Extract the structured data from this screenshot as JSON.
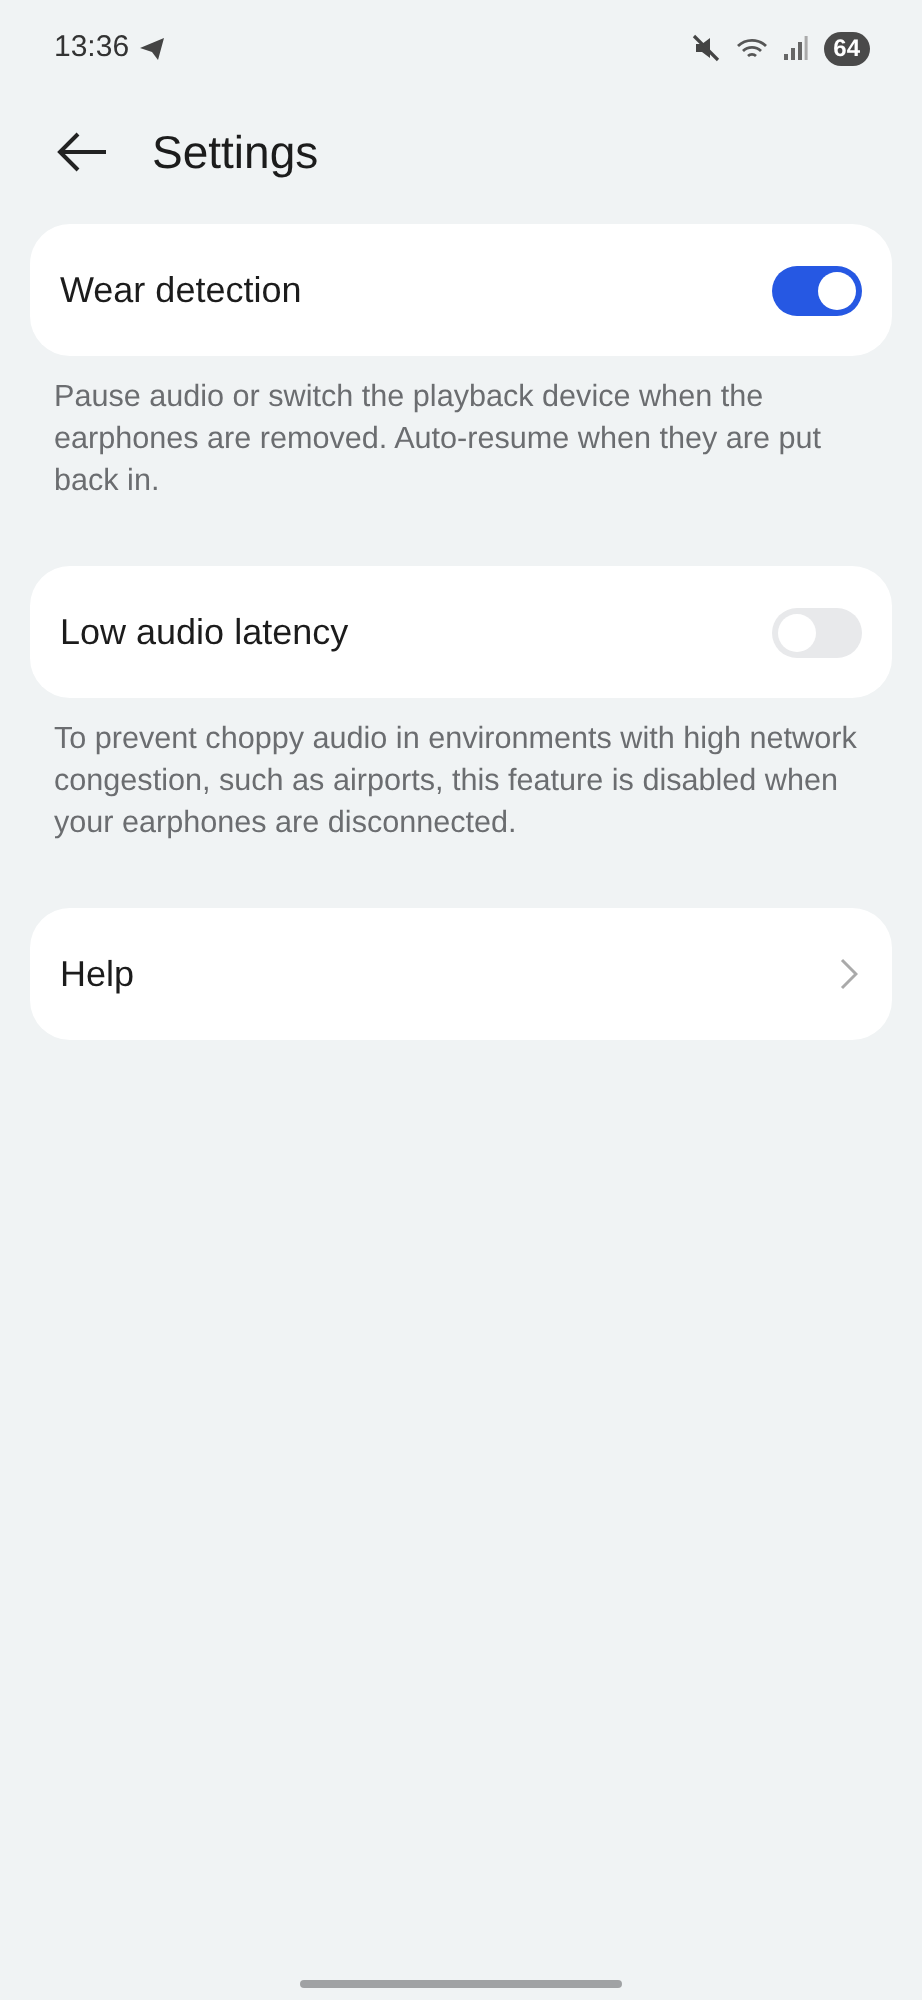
{
  "status_bar": {
    "time": "13:36",
    "battery": "64"
  },
  "header": {
    "title": "Settings"
  },
  "items": [
    {
      "kind": "toggle",
      "label": "Wear detection",
      "on": true,
      "description": "Pause audio or switch the playback device when the earphones are removed. Auto-resume when they are put back in."
    },
    {
      "kind": "toggle",
      "label": "Low audio latency",
      "on": false,
      "description": "To prevent choppy audio in environments with high network congestion, such as airports, this feature is disabled when your earphones are disconnected."
    },
    {
      "kind": "link",
      "label": "Help"
    }
  ]
}
